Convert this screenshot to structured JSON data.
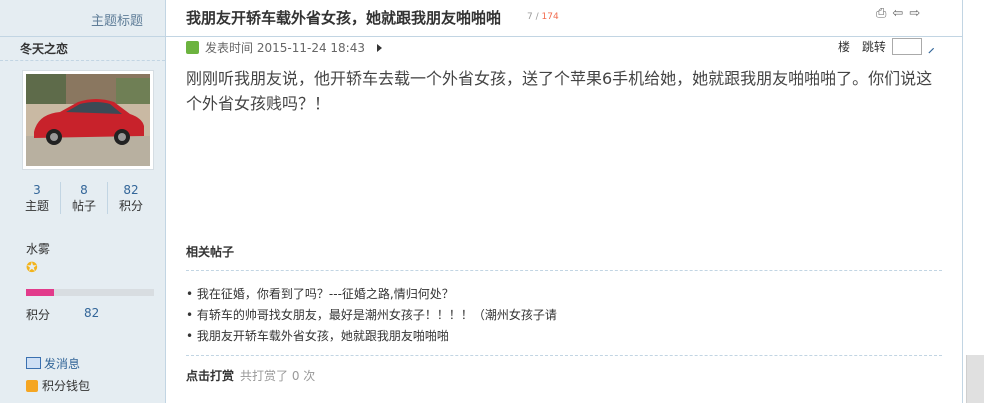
{
  "sidebar": {
    "header": "主题标题",
    "author": "冬天之恋",
    "stats": [
      {
        "num": "3",
        "label": "主题"
      },
      {
        "num": "8",
        "label": "帖子"
      },
      {
        "num": "82",
        "label": "积分"
      }
    ],
    "group": "水雾",
    "credit_label": "积分",
    "credit_value": "82",
    "credit_progress_percent": 22,
    "send_message": "发消息",
    "wallet": "积分钱包"
  },
  "post": {
    "title": "我朋友开轿车载外省女孩，她就跟我朋友啪啪啪",
    "page_current": "7",
    "page_sep": " / ",
    "page_total": "174",
    "posted_label": "发表时间",
    "posted_time": "2015-11-24 18:43",
    "floor_label": "楼",
    "jump_label": "跳转",
    "body": "刚刚听我朋友说，他开轿车去载一个外省女孩，送了个苹果6手机给她，她就跟我朋友啪啪啪了。你们说这个外省女孩贱吗？！"
  },
  "related": {
    "title": "相关帖子",
    "items": [
      "我在征婚，你看到了吗？---征婚之路,情归何处？",
      "有轿车的帅哥找女朋友，最好是潮州女孩子！！！！（潮州女孩子请",
      "我朋友开轿车载外省女孩，她就跟我朋友啪啪啪"
    ]
  },
  "tip": {
    "label": "点击打赏",
    "count_text": "共打赏了 0 次"
  },
  "icons": {
    "print": "print-icon",
    "prev": "prev-thread-icon",
    "next": "next-thread-icon"
  }
}
